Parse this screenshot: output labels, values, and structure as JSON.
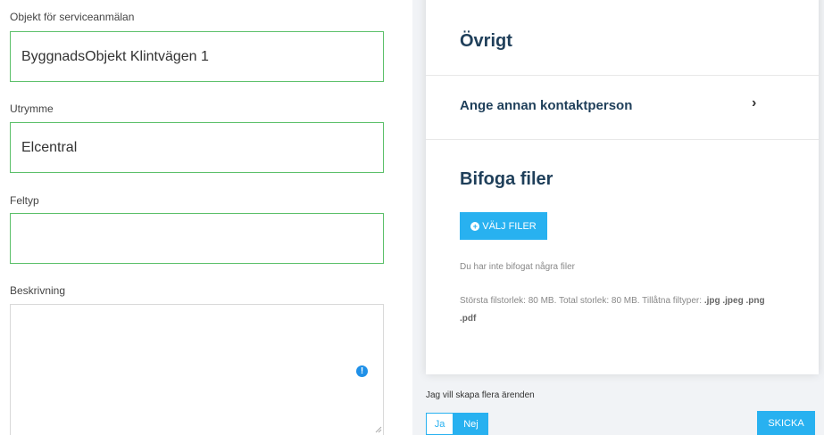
{
  "form": {
    "object_label": "Objekt för serviceanmälan",
    "object_value": "ByggnadsObjekt Klintvägen 1",
    "space_label": "Utrymme",
    "space_value": "Elcentral",
    "fault_label": "Feltyp",
    "fault_value": "",
    "description_label": "Beskrivning",
    "description_value": "",
    "warning_icon_glyph": "!"
  },
  "panel": {
    "other_heading": "Övrigt",
    "contact_label": "Ange annan kontaktperson",
    "chevron_glyph": "›",
    "attach_heading": "Bifoga filer",
    "choose_files_label": "VÄLJ FILER",
    "plus_glyph": "+",
    "no_files_text": "Du har inte bifogat några filer",
    "limits_text": "Största filstorlek: 80 MB. Total storlek: 80 MB. Tillåtna filtyper: ",
    "file_types": ".jpg .jpeg .png .pdf"
  },
  "footer": {
    "multi_label": "Jag vill skapa flera ärenden",
    "yes_label": "Ja",
    "no_label": "Nej",
    "send_label": "SKICKA"
  },
  "colors": {
    "accent": "#28b1f0",
    "valid_border": "#5cc06a",
    "heading": "#1f3f5a",
    "warning_icon": "#1f90e8"
  },
  "icons": [
    "chevron-right-icon",
    "plus-circle-icon",
    "warning-icon",
    "resize-handle-icon"
  ]
}
